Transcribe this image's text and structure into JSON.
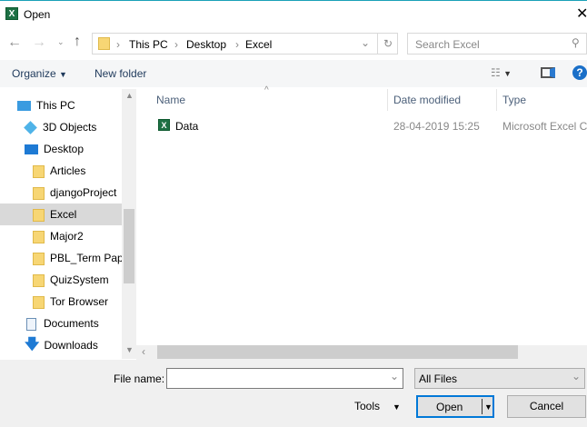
{
  "title": "Open",
  "breadcrumb": [
    "This PC",
    "Desktop",
    "Excel"
  ],
  "search_placeholder": "Search Excel",
  "toolbar": {
    "organize": "Organize",
    "new_folder": "New folder"
  },
  "sidebar": [
    {
      "label": "This PC",
      "icon": "computer-icon"
    },
    {
      "label": "3D Objects",
      "icon": "cube-icon"
    },
    {
      "label": "Desktop",
      "icon": "desktop-icon"
    },
    {
      "label": "Articles",
      "icon": "folder-icon"
    },
    {
      "label": "djangoProject",
      "icon": "folder-icon"
    },
    {
      "label": "Excel",
      "icon": "folder-icon",
      "selected": true
    },
    {
      "label": "Major2",
      "icon": "folder-icon"
    },
    {
      "label": "PBL_Term Paper",
      "icon": "folder-icon"
    },
    {
      "label": "QuizSystem",
      "icon": "folder-icon"
    },
    {
      "label": "Tor Browser",
      "icon": "folder-icon"
    },
    {
      "label": "Documents",
      "icon": "documents-icon"
    },
    {
      "label": "Downloads",
      "icon": "download-icon"
    }
  ],
  "columns": {
    "name": "Name",
    "date": "Date modified",
    "type": "Type"
  },
  "files": [
    {
      "name": "Data",
      "date": "28-04-2019 15:25",
      "type": "Microsoft Excel C..."
    }
  ],
  "footer": {
    "file_name_label": "File name:",
    "file_name_value": "",
    "filter": "All Files",
    "tools": "Tools",
    "open": "Open",
    "cancel": "Cancel"
  }
}
